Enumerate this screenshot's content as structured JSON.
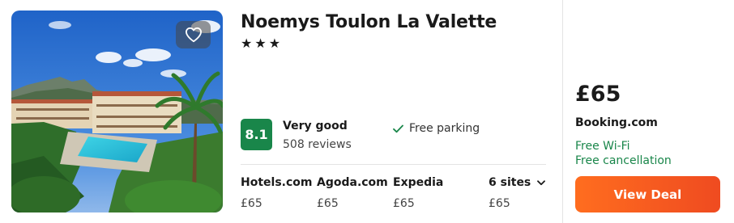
{
  "hotel": {
    "name": "Noemys Toulon La Valette",
    "stars": "★★★",
    "rating_score": "8.1",
    "rating_label": "Very good",
    "rating_reviews": "508 reviews",
    "amenity": "Free parking",
    "favorite_icon": "heart-outline-icon"
  },
  "sites": [
    {
      "name": "Hotels.com",
      "price": "£65"
    },
    {
      "name": "Agoda.com",
      "price": "£65"
    },
    {
      "name": "Expedia",
      "price": "£65"
    }
  ],
  "more_sites": {
    "label": "6 sites",
    "price": "£65",
    "icon": "chevron-down-icon"
  },
  "deal": {
    "price": "£65",
    "provider": "Booking.com",
    "features": [
      "Free Wi-Fi",
      "Free cancellation"
    ],
    "button_label": "View Deal"
  },
  "colors": {
    "rating_green": "#19864a",
    "feature_green": "#19864a",
    "button_orange": "#ff6d1f"
  }
}
